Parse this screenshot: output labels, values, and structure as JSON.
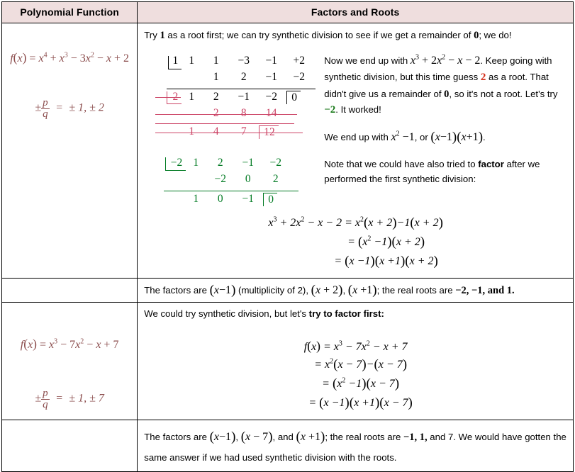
{
  "header": {
    "col1": "Polynomial Function",
    "col2": "Factors and Roots",
    "bg": "#EFDEDE"
  },
  "colors": {
    "maroon": "#8A4B4B",
    "red": "#CC4466",
    "red_bold": "#D42B16",
    "green": "#007A22",
    "green_bold": "#1A7A1A"
  },
  "row1": {
    "left": {
      "fx_label": "f",
      "fx_arg": "(x)",
      "fx_eq": "= x",
      "fx_terms": "+ x",
      "rational_label": "±",
      "rational_num": "p",
      "rational_den": "q",
      "rational_equals": "=",
      "rational_values": "± 1, ± 2",
      "fx_text": "f(x) = x⁴ + x³ − 3x² − x + 2"
    },
    "intro": {
      "t1": "Try ",
      "t2": "1",
      "t3": " as a root first; we can try synthetic division to see if we get a remainder of ",
      "t4": "0",
      "t5": "; we do!"
    },
    "synth1": {
      "divisor": "1",
      "row_top": [
        "1",
        "1",
        "−3",
        "−1",
        "+2"
      ],
      "row_mid": [
        "",
        "1",
        "2",
        "−1",
        "−2"
      ],
      "row_bot": [
        "1",
        "2",
        "−1",
        "−2"
      ],
      "remainder": "0"
    },
    "synth2_struck": {
      "divisor": "2",
      "row_mid": [
        "2",
        "8",
        "14"
      ],
      "row_bot": [
        "1",
        "4",
        "7"
      ],
      "remainder": "12"
    },
    "synth3": {
      "divisor": "−2",
      "row_top": [
        "1",
        "2",
        "−1",
        "−2"
      ],
      "row_mid": [
        "",
        "−2",
        "0",
        "2"
      ],
      "row_bot": [
        "1",
        "0",
        "−1"
      ],
      "remainder": "0"
    },
    "para1": {
      "a": "Now we end up with ",
      "expr": "x³ + 2x² − x − 2",
      "b": ".  Keep going with synthetic division, but this time guess ",
      "guess": "2",
      "c": " as a root.  That didn't give us a remainder of ",
      "zero": "0",
      "d": ", so it's not a root.  Let's try ",
      "guess2": "−2",
      "e": ".  It worked!"
    },
    "para2": {
      "a": "We end up with ",
      "expr1": "x² − 1",
      "b": ", or ",
      "expr2": "(x − 1)(x + 1)",
      "c": "."
    },
    "para3": {
      "a": "Note that we could have also tried to ",
      "bold": "factor",
      "b": " after we performed the first synthetic division:"
    },
    "factoring": {
      "line1_lhs": "x³ + 2x² − x − 2",
      "line1_rhs": "= x²(x + 2) − 1(x + 2)",
      "line2": "= (x² − 1)(x + 2)",
      "line3": "= (x − 1)(x + 1)(x + 2)"
    },
    "conclusion": {
      "a": "The factors are ",
      "f1": "(x − 1)",
      "b": " (multiplicity of 2), ",
      "f2": "(x + 2)",
      "c": ", ",
      "f3": "(x + 1)",
      "d": ";  the real roots are ",
      "r": "−2, −1, and 1."
    }
  },
  "row2": {
    "left": {
      "fx_text": "f(x) = x³ − 7x² − x + 7",
      "rational_num": "p",
      "rational_den": "q",
      "rational_values": "± 1, ± 7"
    },
    "intro": {
      "a": "We could try synthetic division, but let's ",
      "bold": "try to factor first:"
    },
    "factoring": {
      "line1_lhs": "f(x)",
      "line1_rhs": "= x³ − 7x² − x + 7",
      "line2": "= x²(x − 7) − (x − 7)",
      "line3": "= (x² − 1)(x − 7)",
      "line4": "= (x − 1)(x + 1)(x − 7)"
    },
    "conclusion": {
      "a": "The factors are ",
      "f1": "(x − 1)",
      "b": ", ",
      "f2": "(x − 7)",
      "c": ",  and ",
      "f3": "(x + 1)",
      "d": "; the real roots are ",
      "r": "−1, 1,",
      "e": " and 7. We would have gotten the same answer if we had used synthetic division with the roots."
    }
  }
}
